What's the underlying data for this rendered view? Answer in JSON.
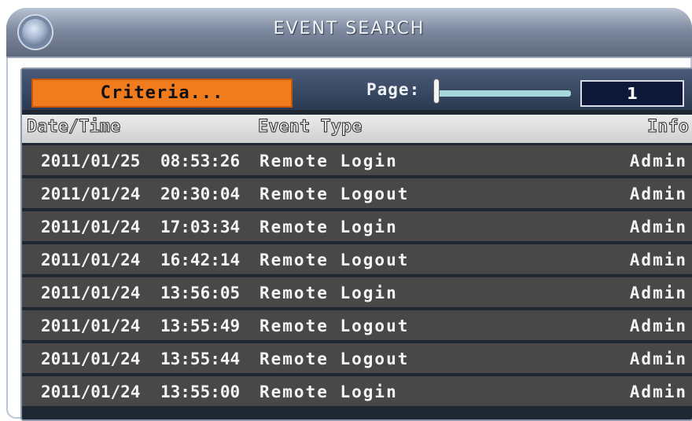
{
  "window": {
    "title": "EVENT SEARCH"
  },
  "controls": {
    "criteria_label": "Criteria...",
    "page_label": "Page:",
    "page_value": "1",
    "page_slider_fraction": 0.0
  },
  "table": {
    "headers": {
      "datetime": "Date/Time",
      "event_type": "Event Type",
      "info": "Info"
    },
    "rows": [
      {
        "date": "2011/01/25",
        "time": "08:53:26",
        "event_type": "Remote Login",
        "info": "Admin"
      },
      {
        "date": "2011/01/24",
        "time": "20:30:04",
        "event_type": "Remote Logout",
        "info": "Admin"
      },
      {
        "date": "2011/01/24",
        "time": "17:03:34",
        "event_type": "Remote Login",
        "info": "Admin"
      },
      {
        "date": "2011/01/24",
        "time": "16:42:14",
        "event_type": "Remote Logout",
        "info": "Admin"
      },
      {
        "date": "2011/01/24",
        "time": "13:56:05",
        "event_type": "Remote Login",
        "info": "Admin"
      },
      {
        "date": "2011/01/24",
        "time": "13:55:49",
        "event_type": "Remote Logout",
        "info": "Admin"
      },
      {
        "date": "2011/01/24",
        "time": "13:55:44",
        "event_type": "Remote Logout",
        "info": "Admin"
      },
      {
        "date": "2011/01/24",
        "time": "13:55:00",
        "event_type": "Remote Login",
        "info": "Admin"
      }
    ]
  },
  "colors": {
    "accent": "#f07c1e",
    "panel_bg": "#1f2733",
    "row_bg": "#484848",
    "slider_track": "#a7d7dd",
    "page_box_bg": "#0d1838"
  }
}
